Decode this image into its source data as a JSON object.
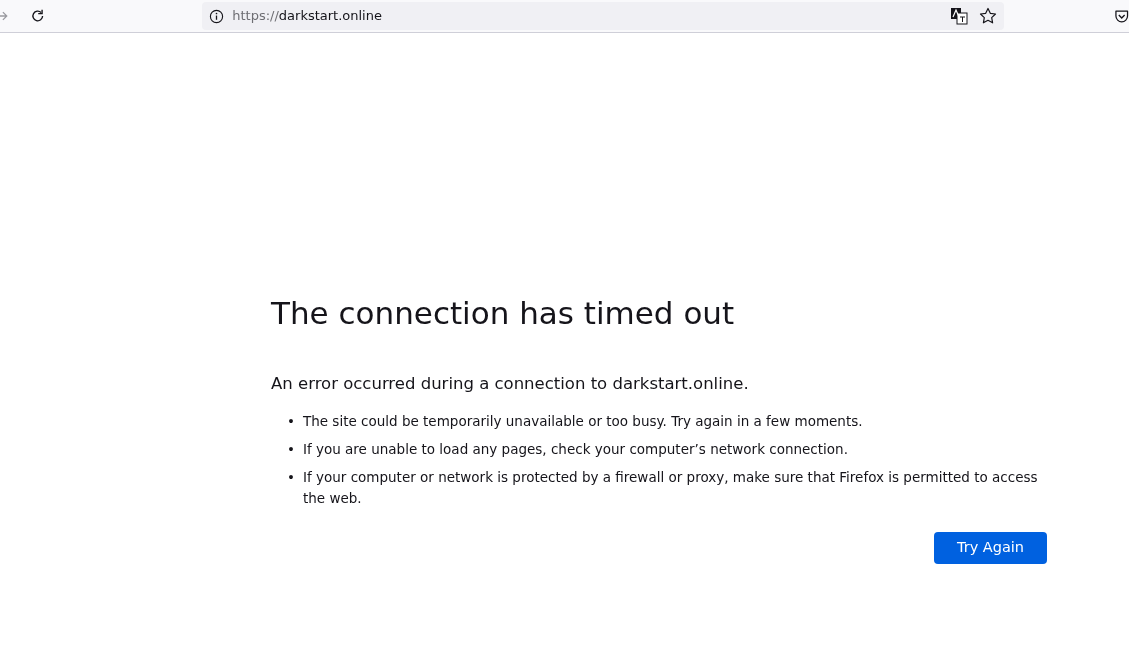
{
  "toolbar": {
    "url": {
      "scheme": "https://",
      "host": "darkstart.online"
    }
  },
  "error": {
    "title": "The connection has timed out",
    "message": "An error occurred during a connection to darkstart.online.",
    "tips": [
      {
        "bullet": "•",
        "text": "The site could be temporarily unavailable or too busy. Try again in a few moments."
      },
      {
        "bullet": "•",
        "text": "If you are unable to load any pages, check your computer’s network connection."
      },
      {
        "bullet": "•",
        "text": "If your computer or network is protected by a firewall or proxy, make sure that Firefox is permitted to access the web."
      }
    ],
    "button": "Try Again"
  }
}
